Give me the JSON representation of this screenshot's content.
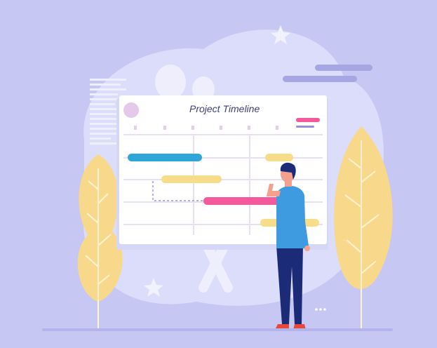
{
  "illustration": {
    "title": "Project Timeline",
    "colors": {
      "background": "#c6c7f3",
      "blob": "#dcdcfb",
      "board": "#ffffff",
      "grid": "#e9dff2",
      "bar_blue": "#2fa6d8",
      "bar_yellow": "#f7dc8a",
      "bar_pink": "#f25a9b",
      "shirt": "#3f9be0",
      "pants": "#1c2b78",
      "hair": "#1c2b78",
      "skin": "#f4a08c",
      "shoes": "#e8473b",
      "plant": "#f8d98c"
    }
  }
}
